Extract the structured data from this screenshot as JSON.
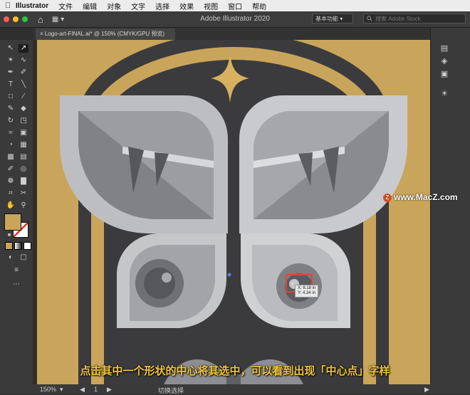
{
  "menubar": {
    "app_name": "Illustrator",
    "items": [
      "文件",
      "编辑",
      "对象",
      "文字",
      "选择",
      "效果",
      "视图",
      "窗口",
      "帮助"
    ]
  },
  "appbar": {
    "title": "Adobe Illustrator 2020",
    "workspace": "基本功能",
    "workspace_arrow": "▾",
    "search_placeholder": "搜索 Adobe Stock",
    "home_icon": "⌂",
    "layout_icon": "▦ ▾"
  },
  "document_tab": {
    "close": "×",
    "label": "Logo-art-FINAL.ai* @ 150% (CMYK/GPU 预览)"
  },
  "canvas": {
    "tooltip_x": "X: 6.18 in",
    "tooltip_y": "Y: 4.34 in",
    "center_mark": "×"
  },
  "watermark": {
    "logo": "Z",
    "text": "www.MacZ.com"
  },
  "caption": "点击其中一个形状的中心将其选中，可以看到出现「中心点」字样",
  "statusbar": {
    "zoom": "150%",
    "zoom_arrow": "▾",
    "artboard_prev": "◀",
    "artboard": "1",
    "artboard_next": "▶",
    "mode": "切换选择",
    "right_arrow": "▶"
  },
  "colors": {
    "gold": "#c9a55b",
    "dark": "#3b3b3d",
    "wing_light": "#c5c6c8",
    "accent_red": "#e0453a"
  }
}
